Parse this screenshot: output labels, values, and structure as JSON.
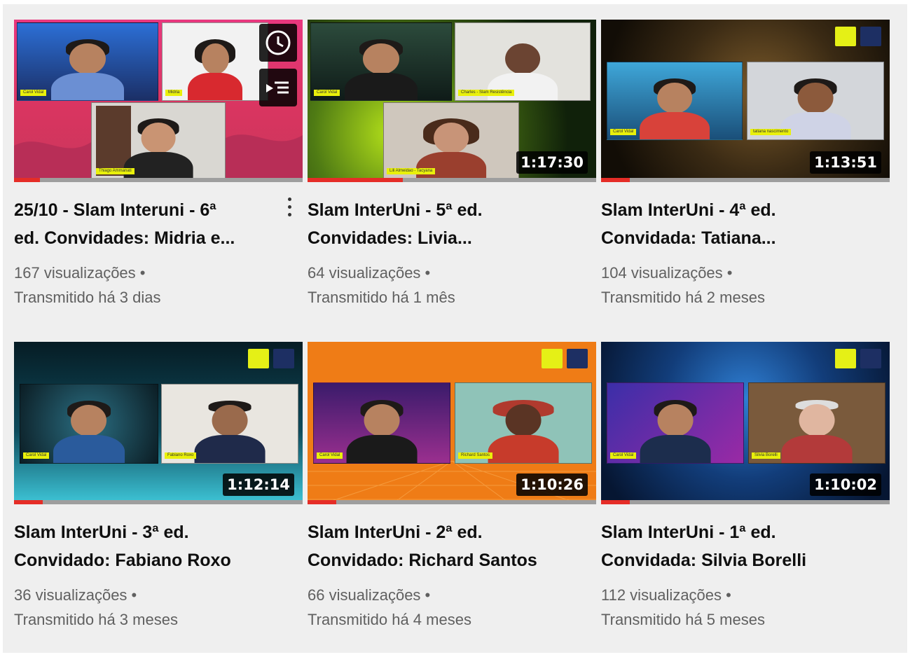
{
  "videos": [
    {
      "title_line1": "25/10 - Slam Interuni - 6ª",
      "title_line2": "ed. Convidades: Midria e...",
      "views": "167 visualizações •",
      "streamed": "Transmitido há 3 dias",
      "duration": "",
      "progress": 0.09,
      "name_tags": [
        "Carol Vidal",
        "Midria",
        "Thiago Ammanati"
      ],
      "hover_controls": [
        "watch-later-icon",
        "add-to-queue-icon"
      ],
      "has_menu": true
    },
    {
      "title_line1": "Slam InterUni - 5ª ed.",
      "title_line2": "Convidades: Livia...",
      "views": "64 visualizações •",
      "streamed": "Transmitido há 1 mês",
      "duration": "1:17:30",
      "progress": 0.33,
      "name_tags": [
        "Carol Vidal",
        "Charles - Slam Resistência",
        "Lili Almeidao - Tacyana"
      ]
    },
    {
      "title_line1": "Slam InterUni - 4ª ed.",
      "title_line2": "Convidada: Tatiana...",
      "views": "104 visualizações •",
      "streamed": "Transmitido há 2 meses",
      "duration": "1:13:51",
      "progress": 0.1,
      "name_tags": [
        "Carol Vidal",
        "tatiana nascimento"
      ]
    },
    {
      "title_line1": "Slam InterUni - 3ª ed.",
      "title_line2": "Convidado: Fabiano Roxo",
      "views": "36 visualizações •",
      "streamed": "Transmitido há 3 meses",
      "duration": "1:12:14",
      "progress": 0.1,
      "name_tags": [
        "Carol Vidal",
        "Fabiano Roxo"
      ]
    },
    {
      "title_line1": "Slam InterUni - 2ª ed.",
      "title_line2": "Convidado: Richard Santos",
      "views": "66 visualizações •",
      "streamed": "Transmitido há 4 meses",
      "duration": "1:10:26",
      "progress": 0.1,
      "name_tags": [
        "Carol Vidal",
        "Richard Santos"
      ]
    },
    {
      "title_line1": "Slam InterUni - 1ª ed.",
      "title_line2": "Convidada: Silvia Borelli",
      "views": "112 visualizações •",
      "streamed": "Transmitido há 5 meses",
      "duration": "1:10:02",
      "progress": 0.1,
      "name_tags": [
        "Carol Vidal",
        "Silvia Borelli"
      ]
    }
  ],
  "colors": {
    "progress": "#e52d27",
    "title": "#0f0f0f",
    "meta": "#606060",
    "tag": "#e9f00b"
  }
}
